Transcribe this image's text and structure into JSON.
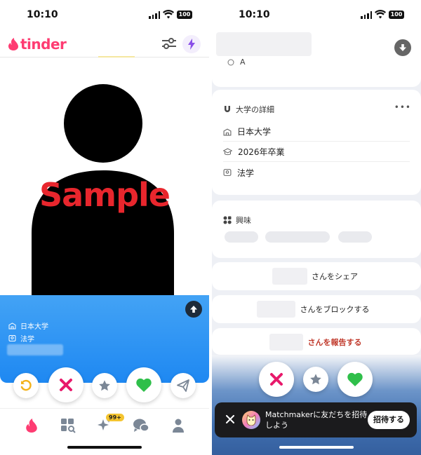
{
  "left": {
    "status": {
      "time": "10:10",
      "battery": "100"
    },
    "header": {
      "logo_text": "tinder"
    },
    "photo": {
      "overlay_text": "Sample"
    },
    "info": {
      "university": "日本大学",
      "major": "法学"
    },
    "tabbar": {
      "badge": "99+"
    }
  },
  "right": {
    "status": {
      "time": "10:10",
      "battery": "100"
    },
    "top": {
      "partial_text": "A"
    },
    "university_card": {
      "title": "大学の詳細",
      "more": "•••",
      "rows": [
        "日本大学",
        "2026年卒業",
        "法学"
      ]
    },
    "interests_card": {
      "title": "興味"
    },
    "actions": {
      "share": "さんをシェア",
      "block": "さんをブロックする",
      "report": "さんを報告する"
    },
    "toast": {
      "message": "Matchmakerに友だちを招待しよう",
      "invite_button": "招待する"
    }
  },
  "colors": {
    "brand": "#fe3c72",
    "nope": "#e8196b",
    "like": "#2fbf4a",
    "rewind": "#f3b21b",
    "boost": "#8a4fe8",
    "panel_blue": "#1e88f2",
    "report_red": "#c0392b"
  }
}
